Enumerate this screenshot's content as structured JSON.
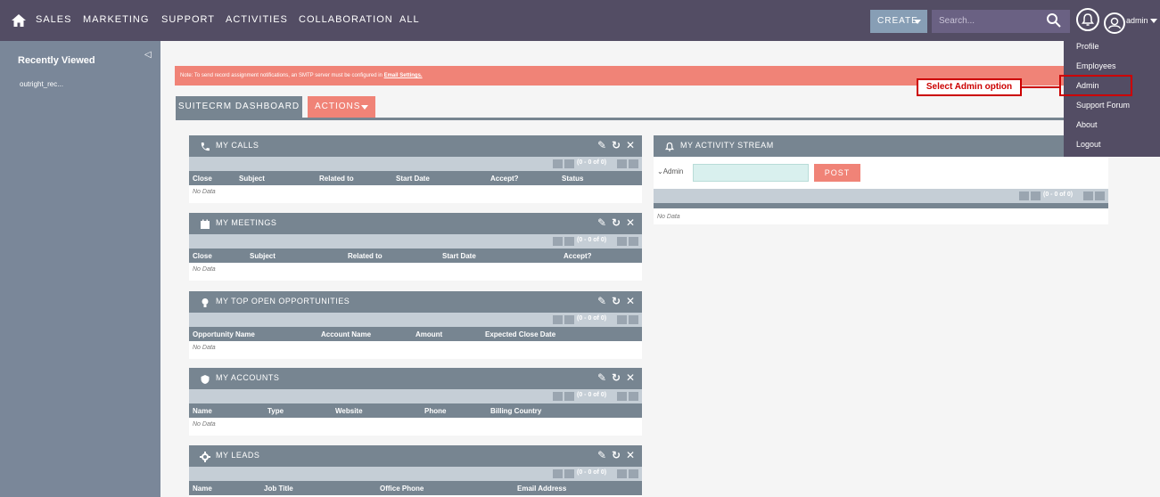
{
  "nav": {
    "items": [
      "SALES",
      "MARKETING",
      "SUPPORT",
      "ACTIVITIES",
      "COLLABORATION",
      "ALL"
    ],
    "create_label": "CREATE",
    "search_placeholder": "Search...",
    "user_label": "admin",
    "icons": {
      "home": "home-icon",
      "search": "search-icon",
      "notifications": "bell-icon",
      "user": "user-icon"
    }
  },
  "sidebar": {
    "title": "Recently Viewed",
    "items": [
      "outright_rec..."
    ]
  },
  "notice": {
    "text": "Note: To send record assignment notifications, an SMTP server must be configured in",
    "link": "Email Settings."
  },
  "tabs": {
    "dashboard": "SUITECRM DASHBOARD",
    "actions": "ACTIONS"
  },
  "dashlets": {
    "calls": {
      "title": "MY CALLS",
      "pager": "(0 - 0 of 0)",
      "columns": [
        "Close",
        "Subject",
        "Related to",
        "Start Date",
        "Accept?",
        "Status"
      ],
      "nodata": "No Data"
    },
    "meetings": {
      "title": "MY MEETINGS",
      "pager": "(0 - 0 of 0)",
      "columns": [
        "Close",
        "Subject",
        "Related to",
        "Start Date",
        "Accept?"
      ],
      "nodata": "No Data"
    },
    "opportunities": {
      "title": "MY TOP OPEN OPPORTUNITIES",
      "pager": "(0 - 0 of 0)",
      "columns": [
        "Opportunity Name",
        "Account Name",
        "Amount",
        "Expected Close Date"
      ],
      "nodata": "No Data"
    },
    "accounts": {
      "title": "MY ACCOUNTS",
      "pager": "(0 - 0 of 0)",
      "columns": [
        "Name",
        "Type",
        "Website",
        "Phone",
        "Billing Country"
      ],
      "nodata": "No Data"
    },
    "leads": {
      "title": "MY LEADS",
      "pager": "(0 - 0 of 0)",
      "columns": [
        "Name",
        "Job Title",
        "Office Phone",
        "Email Address"
      ]
    },
    "activity": {
      "title": "MY ACTIVITY STREAM",
      "user": "Admin",
      "post_label": "POST",
      "pager": "(0 - 0 of 0)",
      "nodata": "No Data"
    }
  },
  "user_menu": {
    "items": [
      "Profile",
      "Employees",
      "Admin",
      "Support Forum",
      "About",
      "Logout"
    ]
  },
  "annotation": {
    "text": "Select Admin option",
    "color": "#cc0000"
  },
  "colors": {
    "navbar": "#534d64",
    "sidebar": "#7a8799",
    "accent": "#f08377",
    "dashlet_header": "#778591"
  }
}
